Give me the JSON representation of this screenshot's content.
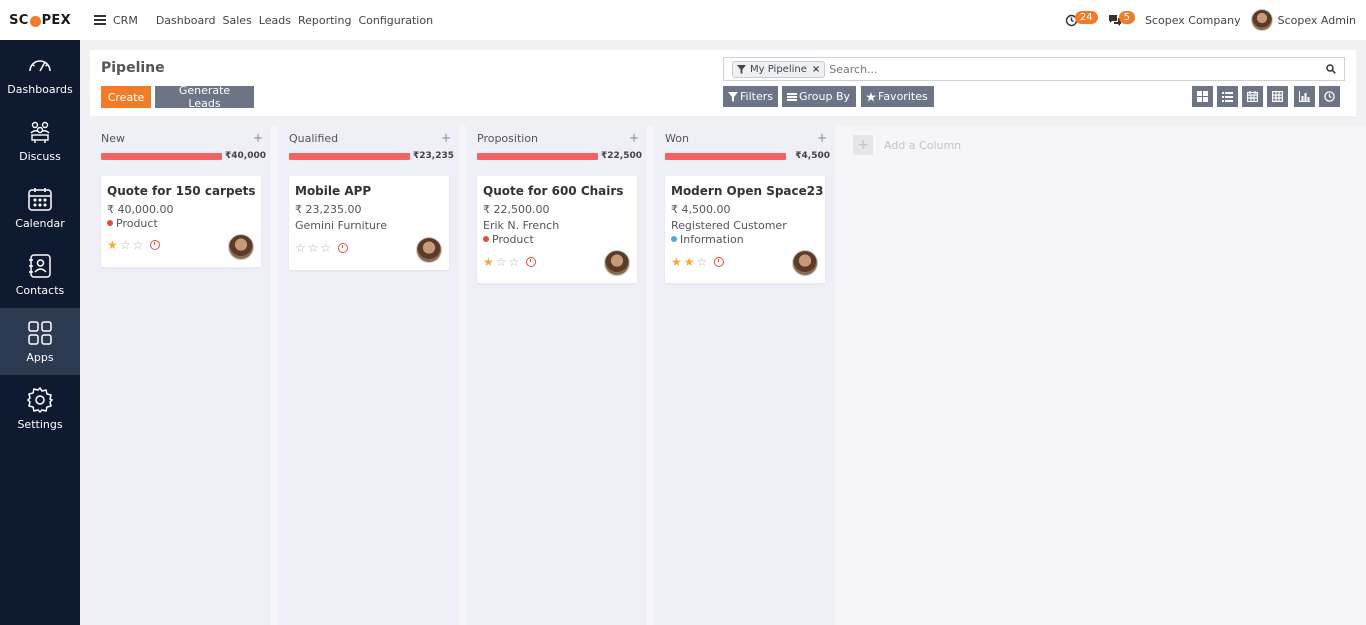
{
  "brand": {
    "logo_left": "SC",
    "logo_right": "PEX",
    "accent": "#f07c2a"
  },
  "sidebar": {
    "items": [
      {
        "label": "Dashboards",
        "icon": "gauge-icon"
      },
      {
        "label": "Discuss",
        "icon": "people-icon"
      },
      {
        "label": "Calendar",
        "icon": "calendar-icon"
      },
      {
        "label": "Contacts",
        "icon": "contact-book-icon"
      },
      {
        "label": "Apps",
        "icon": "grid-icon",
        "active": true
      },
      {
        "label": "Settings",
        "icon": "gear-icon"
      }
    ]
  },
  "topbar": {
    "app": "CRM",
    "menu": [
      "Dashboard",
      "Sales",
      "Leads",
      "Reporting",
      "Configuration"
    ],
    "activity_count": "24",
    "message_count": "5",
    "company": "Scopex Company",
    "user": "Scopex Admin"
  },
  "control": {
    "title": "Pipeline",
    "create": "Create",
    "generate": "Generate Leads",
    "facet": "My Pipeline",
    "search_placeholder": "Search...",
    "filters": "Filters",
    "group_by": "Group By",
    "favorites": "Favorites",
    "views": [
      "kanban-view-icon",
      "list-view-icon",
      "calendar-view-icon",
      "pivot-view-icon",
      "graph-view-icon",
      "activity-view-icon"
    ]
  },
  "columns": [
    {
      "name": "New",
      "total": "₹40,000",
      "card": {
        "title": "Quote for 150 carpets",
        "amount": "₹ 40,000.00",
        "lines": [],
        "tag": "Product",
        "tag_color": "#e74c3c",
        "stars": 1
      }
    },
    {
      "name": "Qualified",
      "total": "₹23,235",
      "card": {
        "title": "Mobile APP",
        "amount": "₹ 23,235.00",
        "lines": [
          "Gemini Furniture"
        ],
        "tag": "",
        "tag_color": "",
        "stars": 0
      }
    },
    {
      "name": "Proposition",
      "total": "₹22,500",
      "card": {
        "title": "Quote for 600 Chairs",
        "amount": "₹ 22,500.00",
        "lines": [
          "Erik N. French"
        ],
        "tag": "Product",
        "tag_color": "#e74c3c",
        "stars": 1
      }
    },
    {
      "name": "Won",
      "total": "₹4,500",
      "card": {
        "title": "Modern Open Space23",
        "amount": "₹ 4,500.00",
        "lines": [
          "Registered Customer"
        ],
        "tag": "Information",
        "tag_color": "#4aa9e3",
        "stars": 2
      }
    }
  ],
  "add_column": "Add a Column"
}
